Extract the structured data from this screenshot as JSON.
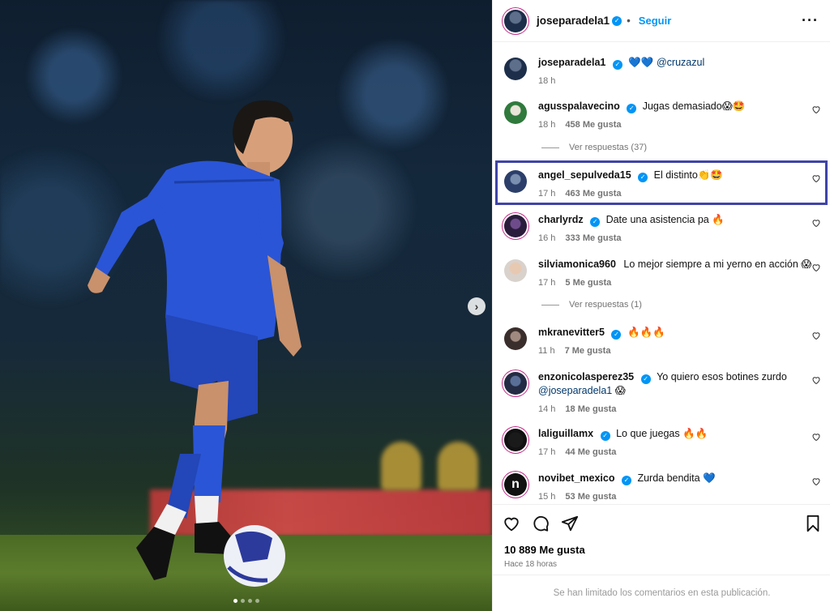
{
  "header": {
    "username": "joseparadela1",
    "separator": "•",
    "follow_label": "Seguir",
    "more_icon": "more-horizontal-icon"
  },
  "caption": {
    "username": "joseparadela1",
    "text": "💙💙",
    "mention": "@cruzazul",
    "time": "18 h"
  },
  "comments": [
    {
      "username": "agusspalavecino",
      "verified": true,
      "text": "Jugas demasiado😱🤩",
      "time": "18 h",
      "likes": "458 Me gusta"
    },
    {
      "username": "angel_sepulveda15",
      "verified": true,
      "text": "El distinto👏🤩",
      "time": "17 h",
      "likes": "463 Me gusta"
    },
    {
      "username": "charlyrdz",
      "verified": true,
      "text": "Date una asistencia pa 🔥",
      "time": "16 h",
      "likes": "333 Me gusta"
    },
    {
      "username": "silviamonica960",
      "verified": false,
      "text": "Lo mejor siempre a mi yerno en acción 😱",
      "time": "17 h",
      "likes": "5 Me gusta"
    },
    {
      "username": "mkranevitter5",
      "verified": true,
      "text": "🔥🔥🔥",
      "time": "11 h",
      "likes": "7 Me gusta"
    },
    {
      "username": "enzonicolasperez35",
      "verified": true,
      "text": "Yo quiero esos botines zurdo",
      "mention": "@joseparadela1",
      "text2": "😱",
      "time": "14 h",
      "likes": "18 Me gusta"
    },
    {
      "username": "laliguillamx",
      "verified": true,
      "text": "Lo que juegas 🔥🔥",
      "time": "17 h",
      "likes": "44 Me gusta"
    },
    {
      "username": "novibet_mexico",
      "verified": true,
      "text": "Zurda bendita 💙",
      "time": "15 h",
      "likes": "53 Me gusta"
    }
  ],
  "replies": [
    {
      "label": "Ver respuestas (37)"
    },
    {
      "label": "Ver respuestas (1)"
    }
  ],
  "actions": {
    "likes_total": "10 889 Me gusta",
    "posted_ago": "Hace 18 horas",
    "comments_limited": "Se han limitado los comentarios en esta publicación."
  },
  "colors": {
    "accent": "#0095f6",
    "highlight": "#3f44a8",
    "jersey": "#2a55d6"
  },
  "carousel": {
    "slide_count": 4,
    "active_slide": 1
  }
}
